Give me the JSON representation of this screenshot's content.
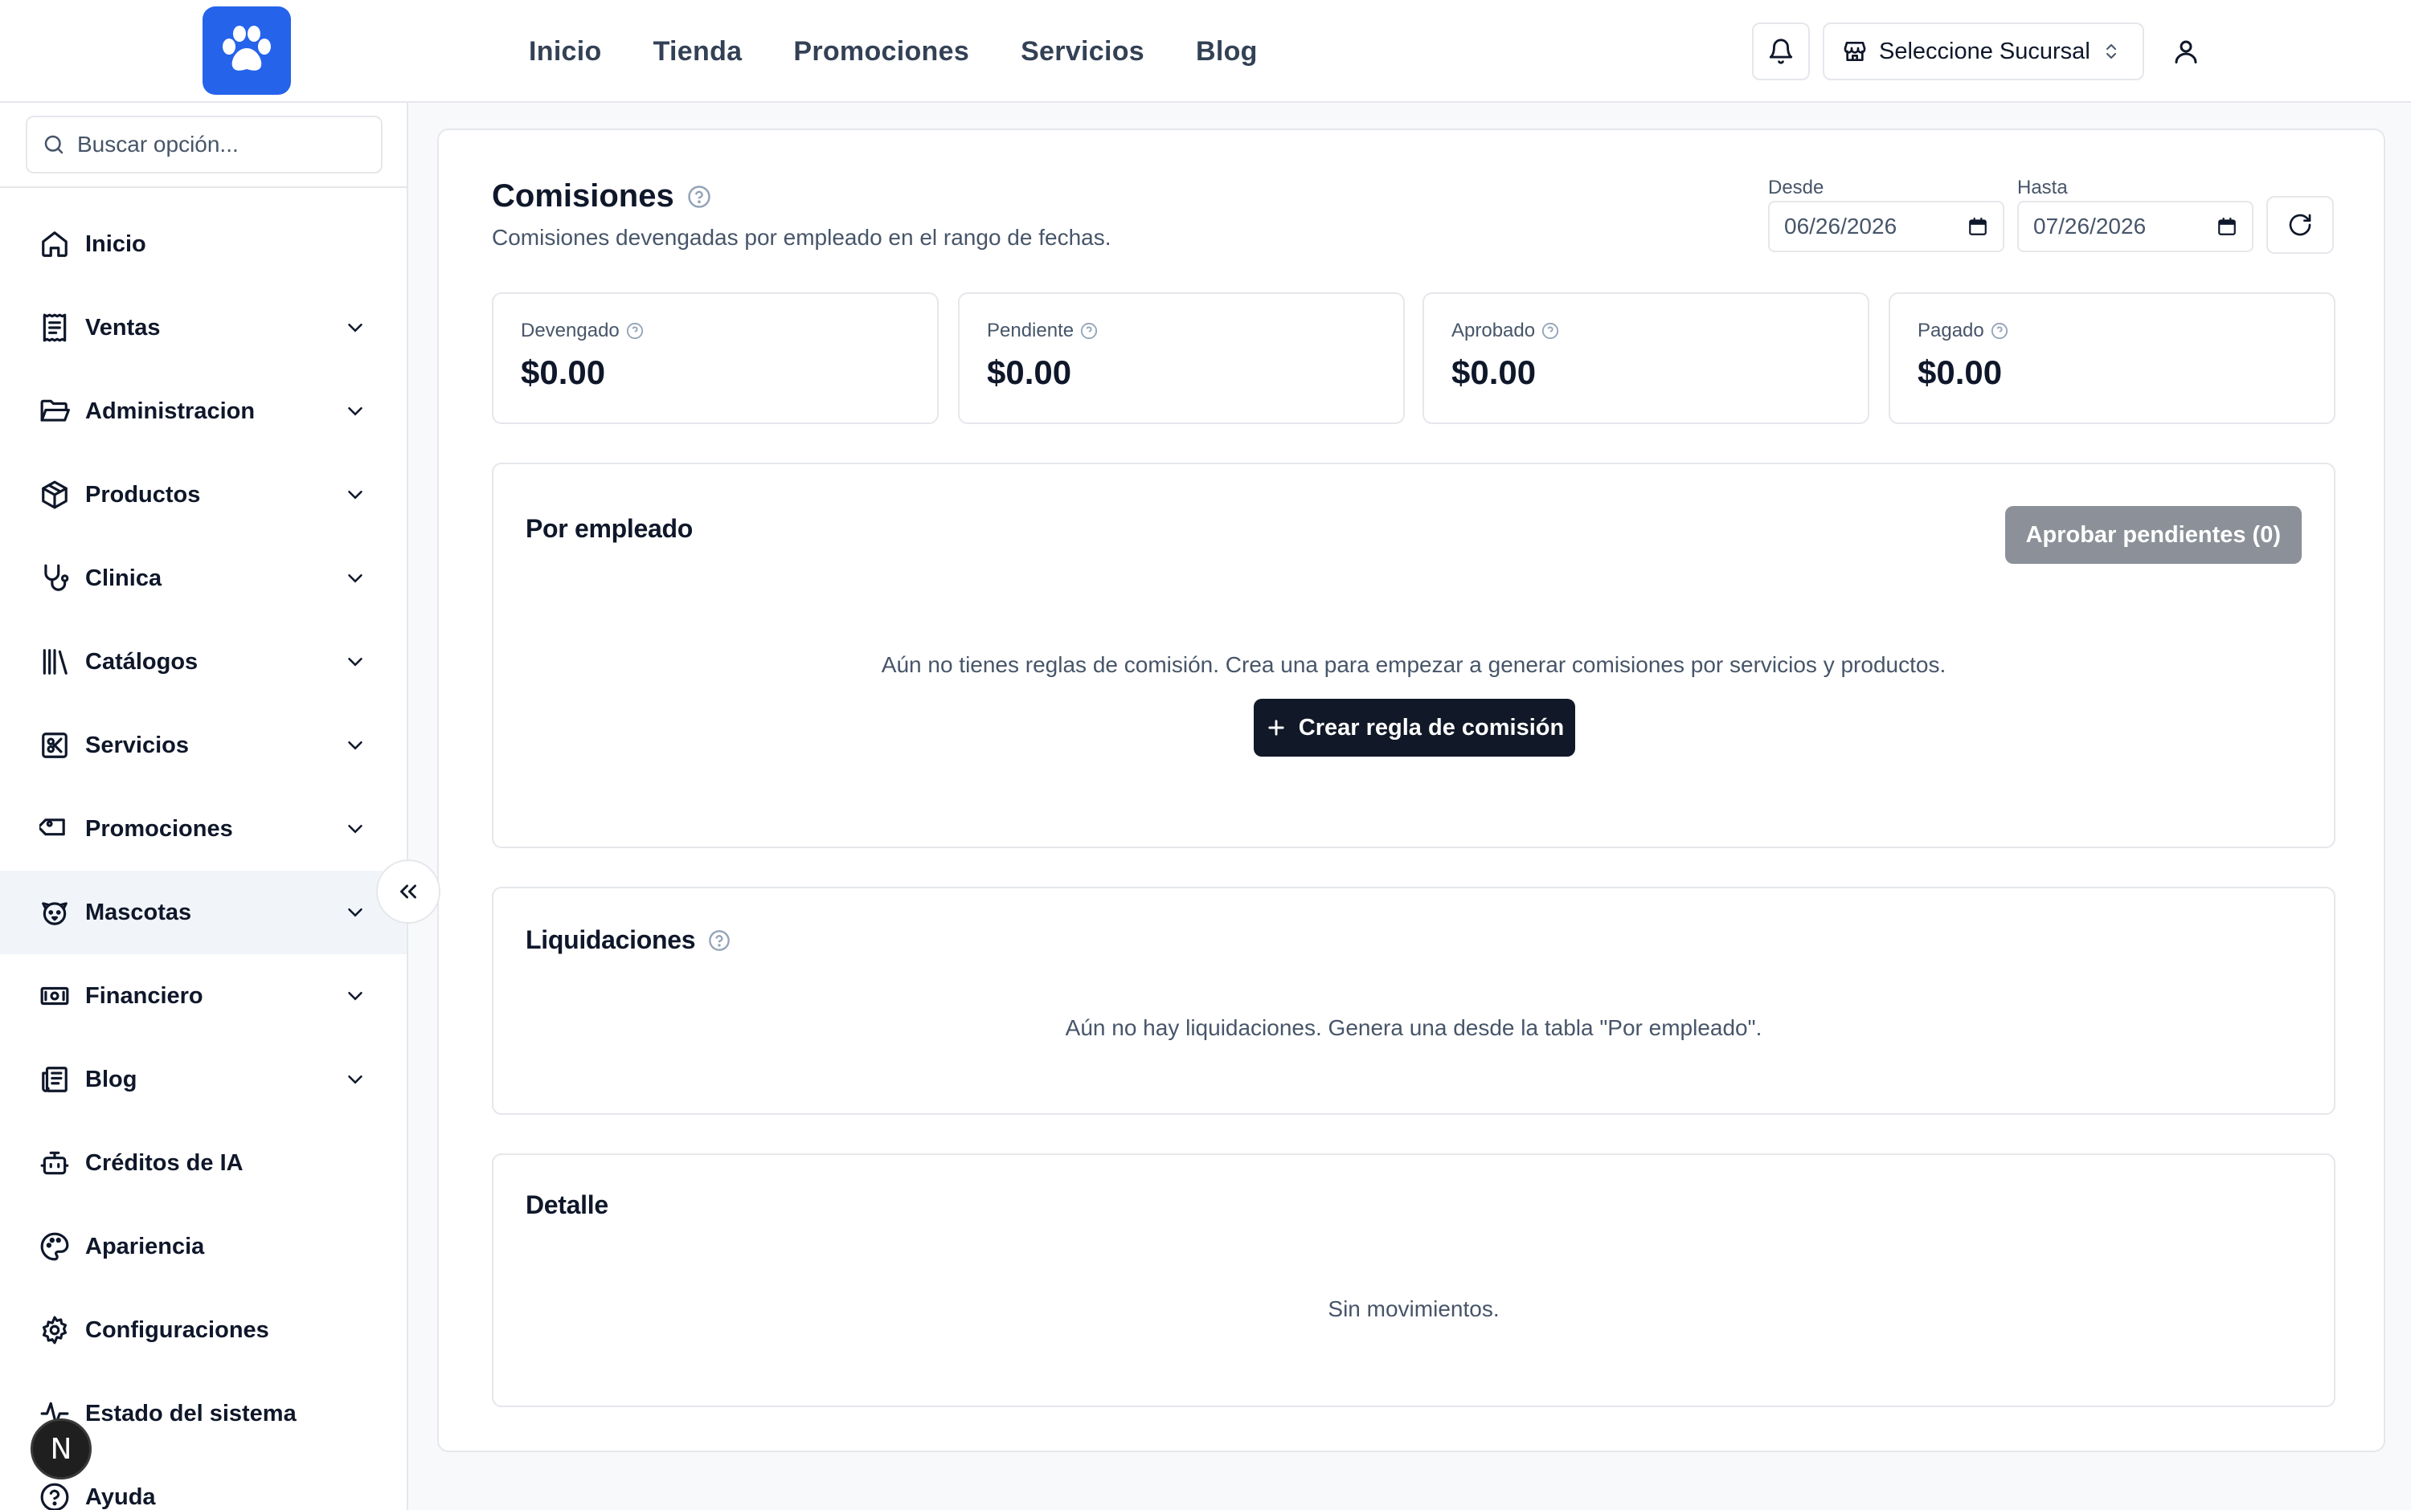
{
  "header": {
    "nav": [
      "Inicio",
      "Tienda",
      "Promociones",
      "Servicios",
      "Blog"
    ],
    "branch_label": "Seleccione Sucursal"
  },
  "sidebar": {
    "search_placeholder": "Buscar opción...",
    "items": [
      {
        "label": "Inicio",
        "icon": "home-icon",
        "expandable": false
      },
      {
        "label": "Ventas",
        "icon": "receipt-icon",
        "expandable": true
      },
      {
        "label": "Administracion",
        "icon": "folder-open-icon",
        "expandable": true
      },
      {
        "label": "Productos",
        "icon": "package-icon",
        "expandable": true
      },
      {
        "label": "Clinica",
        "icon": "stethoscope-icon",
        "expandable": true
      },
      {
        "label": "Catálogos",
        "icon": "library-icon",
        "expandable": true
      },
      {
        "label": "Servicios",
        "icon": "scissors-square-icon",
        "expandable": true
      },
      {
        "label": "Promociones",
        "icon": "tag-icon",
        "expandable": true
      },
      {
        "label": "Mascotas",
        "icon": "dog-icon",
        "expandable": true,
        "active": true
      },
      {
        "label": "Financiero",
        "icon": "banknote-icon",
        "expandable": true
      },
      {
        "label": "Blog",
        "icon": "newspaper-icon",
        "expandable": true
      },
      {
        "label": "Créditos de IA",
        "icon": "bot-icon",
        "expandable": false
      },
      {
        "label": "Apariencia",
        "icon": "palette-icon",
        "expandable": false
      },
      {
        "label": "Configuraciones",
        "icon": "gear-icon",
        "expandable": false
      },
      {
        "label": "Estado del sistema",
        "icon": "activity-icon",
        "expandable": false
      },
      {
        "label": "Ayuda",
        "icon": "help-circle-icon",
        "expandable": false
      }
    ],
    "dev_badge": "N"
  },
  "page": {
    "title": "Comisiones",
    "subtitle": "Comisiones devengadas por empleado en el rango de fechas.",
    "from_label": "Desde",
    "from_value": "06/26/2026",
    "to_label": "Hasta",
    "to_value": "07/26/2026",
    "stats": [
      {
        "label": "Devengado",
        "value": "$0.00"
      },
      {
        "label": "Pendiente",
        "value": "$0.00"
      },
      {
        "label": "Aprobado",
        "value": "$0.00"
      },
      {
        "label": "Pagado",
        "value": "$0.00"
      }
    ],
    "by_employee": {
      "title": "Por empleado",
      "approve_button": "Aprobar pendientes (0)",
      "empty_text": "Aún no tienes reglas de comisión. Crea una para empezar a generar comisiones por servicios y productos.",
      "create_button": "Crear regla de comisión"
    },
    "settlements": {
      "title": "Liquidaciones",
      "empty_text": "Aún no hay liquidaciones. Genera una desde la tabla \"Por empleado\"."
    },
    "detail": {
      "title": "Detalle",
      "empty_text": "Sin movimientos."
    }
  },
  "colors": {
    "brand": "#2563eb",
    "primary_button": "#111827",
    "disabled_button": "#8c9199"
  }
}
